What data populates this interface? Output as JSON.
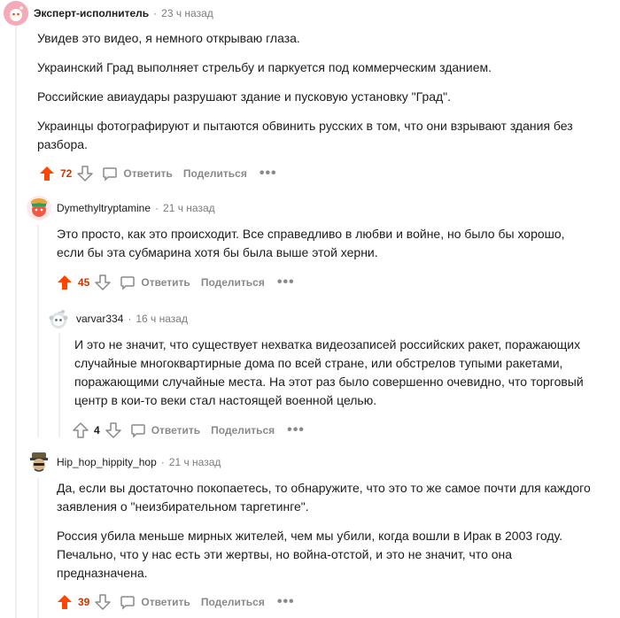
{
  "comments": [
    {
      "author": "Эксперт-исполнитель",
      "time": "23 ч назад",
      "paragraphs": [
        "Увидев это видео, я немного открываю глаза.",
        "Украинский Град выполняет стрельбу и паркуется под коммерческим зданием.",
        "Российские авиаудары разрушают здание и пусковую установку \"Град\".",
        "Украинцы фотографируют и пытаются обвинить русских в том, что они взрывают здания без разбора."
      ],
      "score": "72",
      "upvoted": true,
      "reply_label": "Ответить",
      "share_label": "Поделиться",
      "more_label": "•••"
    },
    {
      "author": "Dymethyltryptamine",
      "time": "21 ч назад",
      "paragraphs": [
        "Это просто, как это происходит. Все справедливо в любви и войне, но было бы хорошо, если бы эта субмарина хотя бы была выше этой херни."
      ],
      "score": "45",
      "upvoted": true,
      "reply_label": "Ответить",
      "share_label": "Поделиться",
      "more_label": "•••"
    },
    {
      "author": "varvar334",
      "time": "16 ч назад",
      "paragraphs": [
        "И это не значит, что существует нехватка видеозаписей российских ракет, поражающих случайные многоквартирные дома по всей стране, или обстрелов тупыми ракетами, поражающими случайные места. На этот раз было совершенно очевидно, что торговый центр в кои-то веки стал настоящей военной целью."
      ],
      "score": "4",
      "upvoted": false,
      "reply_label": "Ответить",
      "share_label": "Поделиться",
      "more_label": "•••"
    },
    {
      "author": "Hip_hop_hippity_hop",
      "time": "21 ч назад",
      "paragraphs": [
        "Да, если вы достаточно покопаетесь, то обнаружите, что это то же самое почти для каждого заявления о \"неизбирательном таргетинге\".",
        "Россия убила меньше мирных жителей, чем мы убили, когда вошли в Ирак в 2003 году. Печально, что у нас есть эти жертвы, но война-отстой, и это не значит, что она предназначена."
      ],
      "score": "39",
      "upvoted": true,
      "reply_label": "Ответить",
      "share_label": "Поделиться",
      "more_label": "•••"
    }
  ],
  "colors": {
    "upvote": "#ff4500",
    "score_up": "#cc3700",
    "meta": "#7c7c7c",
    "action": "#878a8c",
    "thread_line": "#edeff1"
  },
  "icons": {
    "upvote": "arrow-up-icon",
    "downvote": "arrow-down-icon",
    "reply": "speech-bubble-icon"
  }
}
